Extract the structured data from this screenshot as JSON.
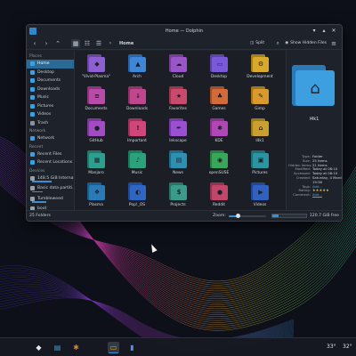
{
  "window": {
    "title": "Home — Dolphin",
    "controls": [
      "▾",
      "▴",
      "✕"
    ]
  },
  "toolbar": {
    "back_icon": "chevron-left-icon",
    "forward_icon": "chevron-right-icon",
    "breadcrumb": "Home",
    "split_label": "Split",
    "hidden_files_label": "Show Hidden Files"
  },
  "sidebar": {
    "sections": [
      {
        "title": "Places",
        "items": [
          {
            "label": "Home",
            "color": "#3d9ee0",
            "selected": true
          },
          {
            "label": "Desktop",
            "color": "#3d9ee0"
          },
          {
            "label": "Documents",
            "color": "#3d9ee0"
          },
          {
            "label": "Downloads",
            "color": "#3d9ee0"
          },
          {
            "label": "Music",
            "color": "#3d9ee0"
          },
          {
            "label": "Pictures",
            "color": "#3d9ee0"
          },
          {
            "label": "Videos",
            "color": "#3d9ee0"
          },
          {
            "label": "Trash",
            "color": "#8c929c"
          }
        ]
      },
      {
        "title": "Network",
        "items": [
          {
            "label": "Network",
            "color": "#3d9ee0"
          }
        ]
      },
      {
        "title": "Recent",
        "items": [
          {
            "label": "Recent Files",
            "color": "#3d9ee0"
          },
          {
            "label": "Recent Locations",
            "color": "#3d9ee0"
          }
        ]
      },
      {
        "title": "Devices",
        "items": [
          {
            "label": "148.5 GiB Internal...",
            "color": "#9aa0aa",
            "eject": true,
            "usage": 0.55
          },
          {
            "label": "Basic data partiti...",
            "color": "#9aa0aa",
            "eject": true,
            "usage": 0.3
          },
          {
            "label": "Tumbleweed",
            "color": "#9aa0aa",
            "eject": false,
            "usage": 0.4
          },
          {
            "label": "boot",
            "color": "#9aa0aa",
            "eject": false
          }
        ]
      }
    ]
  },
  "files": [
    {
      "label": "\"Vivid-Plasma\"",
      "color": "#8e5fd0",
      "glyph": "◆"
    },
    {
      "label": "Arch",
      "color": "#3d86d8",
      "glyph": "▲"
    },
    {
      "label": "Cloud",
      "color": "#9a56c8",
      "glyph": "☁"
    },
    {
      "label": "Desktop",
      "color": "#7a5ad8",
      "glyph": "▭"
    },
    {
      "label": "Development",
      "color": "#d8a92c",
      "glyph": "⚙"
    },
    {
      "label": "Documents",
      "color": "#b84aa8",
      "glyph": "≡"
    },
    {
      "label": "Downloads",
      "color": "#c0478e",
      "glyph": "↓"
    },
    {
      "label": "Favorites",
      "color": "#c94a6c",
      "glyph": "★"
    },
    {
      "label": "Games",
      "color": "#d26a3a",
      "glyph": "♣"
    },
    {
      "label": "Gimp",
      "color": "#d89a2c",
      "glyph": "✎"
    },
    {
      "label": "GitHub",
      "color": "#a24cc4",
      "glyph": "●"
    },
    {
      "label": "Important",
      "color": "#d0467a",
      "glyph": "!"
    },
    {
      "label": "Inkscape",
      "color": "#9a50d0",
      "glyph": "✒"
    },
    {
      "label": "KDE",
      "color": "#b047b4",
      "glyph": "✱"
    },
    {
      "label": "l4k1",
      "color": "#c9a030",
      "glyph": "⌂"
    },
    {
      "label": "Manjaro",
      "color": "#2e9f8e",
      "glyph": "▦"
    },
    {
      "label": "Music",
      "color": "#2aa37c",
      "glyph": "♪"
    },
    {
      "label": "News",
      "color": "#2f8fb0",
      "glyph": "▤"
    },
    {
      "label": "openSUSE",
      "color": "#3aa65a",
      "glyph": "◉"
    },
    {
      "label": "Pictures",
      "color": "#2b94a0",
      "glyph": "▣"
    },
    {
      "label": "Plasma",
      "color": "#2a7ab8",
      "glyph": "❖"
    },
    {
      "label": "Pop!_OS",
      "color": "#2f66c4",
      "glyph": "◐"
    },
    {
      "label": "Projects",
      "color": "#3a9b8a",
      "glyph": "$"
    },
    {
      "label": "Reddit",
      "color": "#c0476a",
      "glyph": "●"
    },
    {
      "label": "Videos",
      "color": "#3060c0",
      "glyph": "▶"
    }
  ],
  "details": {
    "name": "l4k1",
    "rows": [
      {
        "key": "Type:",
        "value": "Folder"
      },
      {
        "key": "Size:",
        "value": "25 items"
      },
      {
        "key": "Hidden items:",
        "value": "21 items"
      },
      {
        "key": "Modified:",
        "value": "Today at 08:10"
      },
      {
        "key": "Accessed:",
        "value": "Today at 08:10"
      },
      {
        "key": "Created:",
        "value": "Saturday, 4 March 2023 at"
      },
      {
        "key": "",
        "value": "19:36"
      },
      {
        "key": "Tags:",
        "value": "Add...",
        "link": true
      },
      {
        "key": "Rating:",
        "value": "★★★★★",
        "stars": true
      },
      {
        "key": "Comment:",
        "value": "Add...",
        "link": true
      }
    ]
  },
  "statusbar": {
    "summary": "25 Folders",
    "zoom_label": "Zoom:",
    "zoom_level": 0.25,
    "free_label": "120.7 GiB free",
    "used_fraction": 0.18
  },
  "taskbar": {
    "apps": [
      {
        "name": "app-launcher-icon",
        "glyph": "◆",
        "color": "#e8e8e8"
      },
      {
        "name": "clipboard-icon",
        "glyph": "▤",
        "color": "#3d9ee0"
      },
      {
        "name": "settings-icon",
        "glyph": "✱",
        "color": "#d8822c"
      },
      {
        "name": "dolphin-icon",
        "glyph": "▭",
        "color": "#d8a92c",
        "active": true
      },
      {
        "name": "konsole-icon",
        "glyph": "▮",
        "color": "#5a8ad8"
      }
    ],
    "temp1": "33°",
    "temp2": "32°"
  },
  "colors": {
    "accent": "#3b8fd0",
    "window_bg": "#1e222a",
    "desktop_bg": "#0d1018"
  }
}
